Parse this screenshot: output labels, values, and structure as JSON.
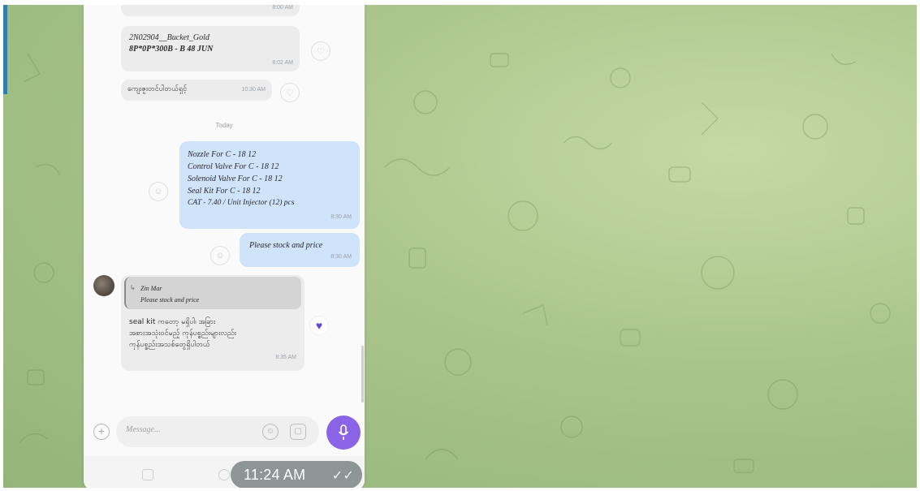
{
  "messages": {
    "top_meta": "8:00 AM",
    "msg1": {
      "line1": "2N02904__Bucket_Gold",
      "line2": "8P*0P*300B  - B 48  JUN",
      "meta": "8:02 AM"
    },
    "msg2": {
      "text": "ကျေးဇူးတင်ပါတယ်ရှင့်",
      "meta": "10:30 AM"
    },
    "date_separator": "Today",
    "msg3": {
      "lines": [
        "Nozzle  For C - 18  12",
        "Control Valve  For C - 18  12",
        "Solenoid Valve  For C - 18  12",
        "Seal Kit For C - 18  12",
        "CAT - 7.40 / Unit Injector (12) pcs"
      ],
      "meta": "8:30 AM"
    },
    "msg4": {
      "text": "Please stock and price",
      "meta": "8:30 AM"
    },
    "msg5": {
      "reply_name": "Zin Mar",
      "reply_text": "Please stock and price",
      "lines": [
        "seal kit ကတော့ မရှိပါ၊ အခြား",
        "အစားအသုံးဝင်မည့် ကုန်ပစ္စည်းများလည်း",
        "ကုန်ပစ္စည်းအသစ်တွေရှိပါတယ်"
      ],
      "meta": "8:35 AM",
      "reaction": "♥"
    }
  },
  "composer": {
    "placeholder": "Message...",
    "plus": "+"
  },
  "overlay_time": "11:24 AM",
  "overlay_ticks": "✓✓",
  "colors": {
    "accent": "#8a63e6",
    "outgoing": "#cfe3fa",
    "incoming": "#ececec",
    "wallpaper": "#a9c58b"
  }
}
